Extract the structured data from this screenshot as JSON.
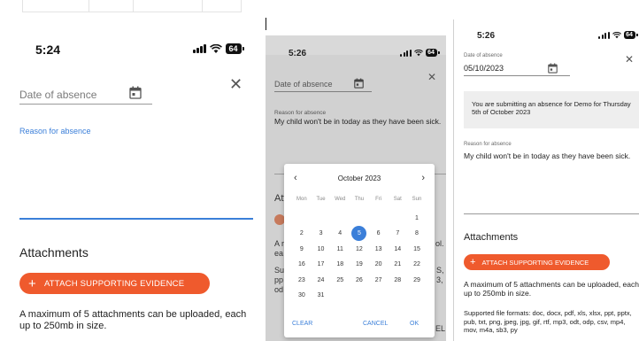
{
  "colors": {
    "accent_blue": "#3b7fd9",
    "accent_orange": "#ef5a2d",
    "dim_overlay": "#d1d1d1",
    "notice_bg": "#eeeeee"
  },
  "panel1": {
    "status": {
      "time": "5:24",
      "battery": "64",
      "icons": [
        "signal-icon",
        "wifi-icon",
        "battery-icon"
      ]
    },
    "date_placeholder": "Date of absence",
    "calendar_icon": "calendar-icon",
    "close_icon": "close-icon",
    "close_glyph": "✕",
    "reason_label": "Reason for absence",
    "attachments_title": "Attachments",
    "attach_button": "ATTACH SUPPORTING EVIDENCE",
    "attach_plus": "+",
    "attach_note": "A maximum of 5 attachments can be uploaded, each up to 250mb in size."
  },
  "panel2": {
    "status": {
      "time": "5:26",
      "battery": "64"
    },
    "date_placeholder": "Date of absence",
    "close_glyph": "✕",
    "reason_label": "Reason for absence",
    "reason_text": "My child won't be in today as they have been sick.",
    "fragments": {
      "f1": "Att",
      "f2": "A r",
      "f3": "ea",
      "f4": "Su",
      "f5": "pp",
      "f6": "od",
      "f7": "ol.",
      "f8": "S,",
      "f9": "3,",
      "f10": "EL"
    },
    "picker": {
      "prev_glyph": "‹",
      "next_glyph": "›",
      "month": "October 2023",
      "weekdays": [
        "Mon",
        "Tue",
        "Wed",
        "Thu",
        "Fri",
        "Sat",
        "Sun"
      ],
      "leading_blanks": 6,
      "days_in_month": 31,
      "selected_day": 5,
      "clear": "CLEAR",
      "cancel": "CANCEL",
      "ok": "OK"
    }
  },
  "panel3": {
    "status": {
      "time": "5:26",
      "battery": "64"
    },
    "date_label": "Date of absence",
    "date_value": "05/10/2023",
    "close_glyph": "✕",
    "notice": "You are submitting an absence for Demo for Thursday 5th of October 2023",
    "reason_label": "Reason for absence",
    "reason_text": "My child won't be in today as they have been sick.",
    "attachments_title": "Attachments",
    "attach_button": "ATTACH SUPPORTING EVIDENCE",
    "attach_plus": "+",
    "attach_note": "A maximum of 5 attachments can be uploaded, each up to 250mb in size.",
    "formats": "Supported file formats: doc, docx, pdf, xls, xlsx, ppt, pptx, pub, txt, png, jpeg, jpg, gif, rtf, mp3, odt, odp, csv, mp4, mov, m4a, sb3, py"
  }
}
